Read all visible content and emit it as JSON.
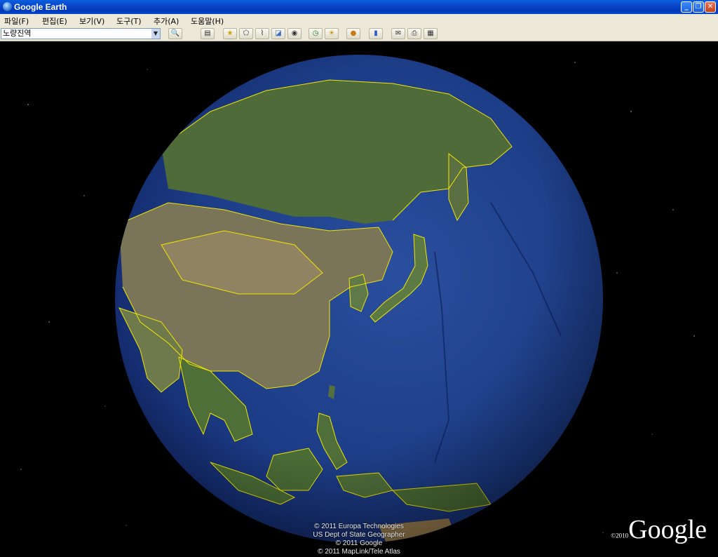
{
  "window": {
    "title": "Google Earth"
  },
  "menu": [
    "파일(F)",
    "편집(E)",
    "보기(V)",
    "도구(T)",
    "추가(A)",
    "도움말(H)"
  ],
  "search": {
    "value": "노량진역"
  },
  "toolbar": {
    "icons": [
      "search-go-icon",
      "sidebar-toggle-icon",
      "placemark-icon",
      "polygon-icon",
      "path-icon",
      "image-overlay-icon",
      "record-tour-icon",
      "historical-imagery-icon",
      "sunlight-icon",
      "switch-planet-icon",
      "ruler-icon",
      "email-icon",
      "print-icon",
      "view-in-maps-icon"
    ]
  },
  "attribution": [
    "© 2011 Europa Technologies",
    "US Dept of State Geographer",
    "© 2011 Google",
    "© 2011 MapLink/Tele Atlas"
  ],
  "logo": {
    "copyright": "©2010",
    "brand": "Google"
  },
  "colors": {
    "border_lines": "#f2e600",
    "ocean": "#1a3a8a",
    "land": "#4e6a38",
    "space": "#000000"
  }
}
